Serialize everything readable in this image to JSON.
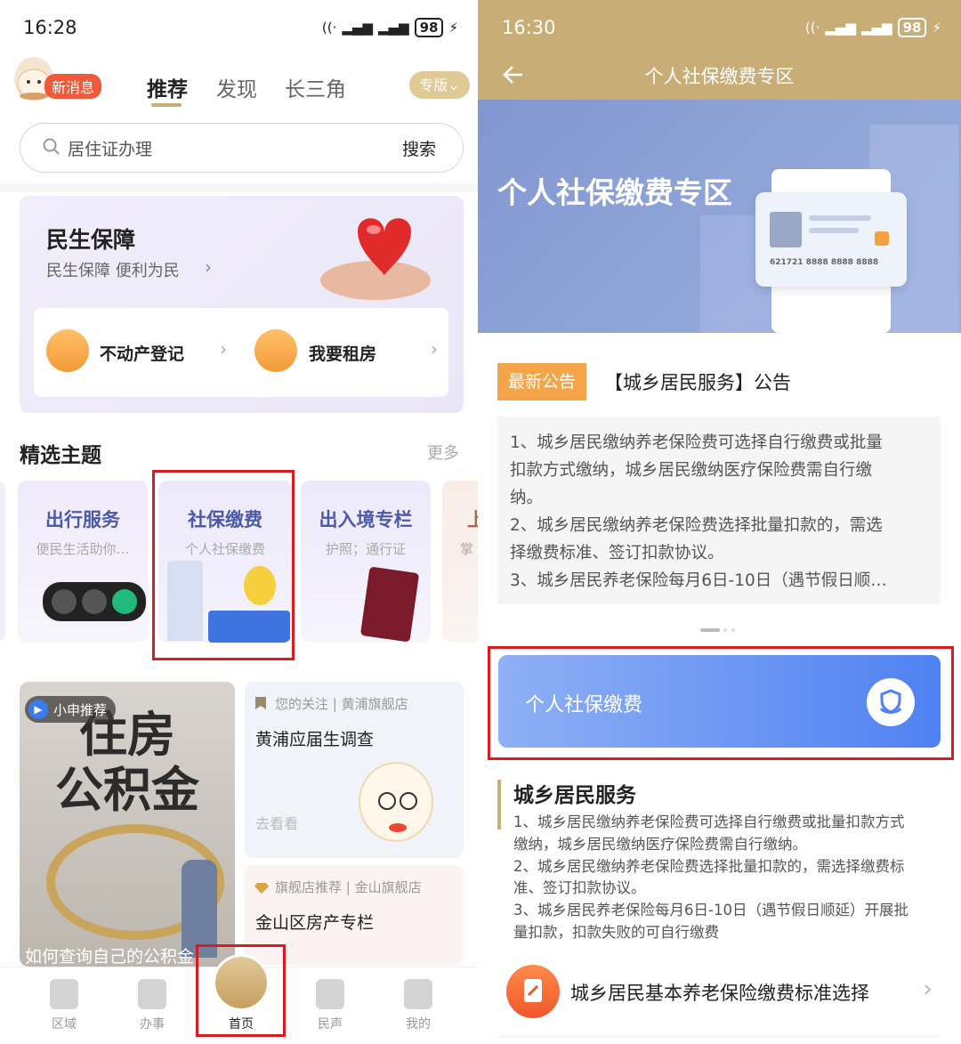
{
  "left": {
    "status": {
      "time": "16:28",
      "battery": "98"
    },
    "header": {
      "badge": "新消息",
      "tabs": [
        "推荐",
        "发现",
        "长三角"
      ],
      "edition_label": "专版"
    },
    "search": {
      "placeholder": "居住证办理",
      "button": "搜索"
    },
    "banner": {
      "title": "民生保障",
      "subtitle": "民生保障 便利为民",
      "links": [
        "不动产登记",
        "我要租房"
      ]
    },
    "featured": {
      "title": "精选主题",
      "more": "更多",
      "cards": [
        {
          "title": "出行服务",
          "subtitle": "便民生活助你…"
        },
        {
          "title": "社保缴费",
          "subtitle": "个人社保缴费"
        },
        {
          "title": "出入境专栏",
          "subtitle": "护照；通行证"
        },
        {
          "title": "上",
          "subtitle": "掌"
        }
      ]
    },
    "feed": {
      "video_badge": "小申推荐",
      "video_poster_text": [
        "住房",
        "公积金"
      ],
      "video_caption": "如何查询自己的公积金",
      "items": [
        {
          "source": "您的关注 | 黄浦旗舰店",
          "title": "黄浦应届生调查",
          "action": "去看看"
        },
        {
          "source": "旗舰店推荐 | 金山旗舰店",
          "title": "金山区房产专栏"
        }
      ]
    },
    "bottom_nav": [
      "区域",
      "办事",
      "首页",
      "民声",
      "我的"
    ]
  },
  "right": {
    "status": {
      "time": "16:30",
      "battery": "98"
    },
    "nav_title": "个人社保缴费专区",
    "hero": {
      "title": "个人社保缴费专区",
      "card_number": "621721 8888 8888 8888"
    },
    "notice": {
      "tag": "最新公告",
      "title": "【城乡居民服务】公告",
      "lines": [
        "1、城乡居民缴纳养老保险费可选择自行缴费或批量",
        "扣款方式缴纳，城乡居民缴纳医疗保险费需自行缴",
        "纳。",
        "2、城乡居民缴纳养老保险费选择批量扣款的，需选",
        "择缴费标准、签订扣款协议。",
        "3、城乡居民养老保险每月6日-10日（遇节假日顺…"
      ]
    },
    "pay_button": "个人社保缴费",
    "service": {
      "title": "城乡居民服务",
      "lines": [
        "1、城乡居民缴纳养老保险费可选择自行缴费或批量扣款方式",
        "缴纳，城乡居民缴纳医疗保险费需自行缴纳。",
        "2、城乡居民缴纳养老保险费选择批量扣款的，需选择缴费标",
        "准、签订扣款协议。",
        "3、城乡居民养老保险每月6日-10日（遇节假日顺延）开展批",
        "量扣款，扣款失败的可自行缴费"
      ]
    },
    "list_item": "城乡居民基本养老保险缴费标准选择"
  },
  "colors": {
    "accent_gold": "#c9ad77",
    "primary_blue": "#4f81f2",
    "highlight_red": "#d71d22",
    "orange": "#f39a37"
  }
}
